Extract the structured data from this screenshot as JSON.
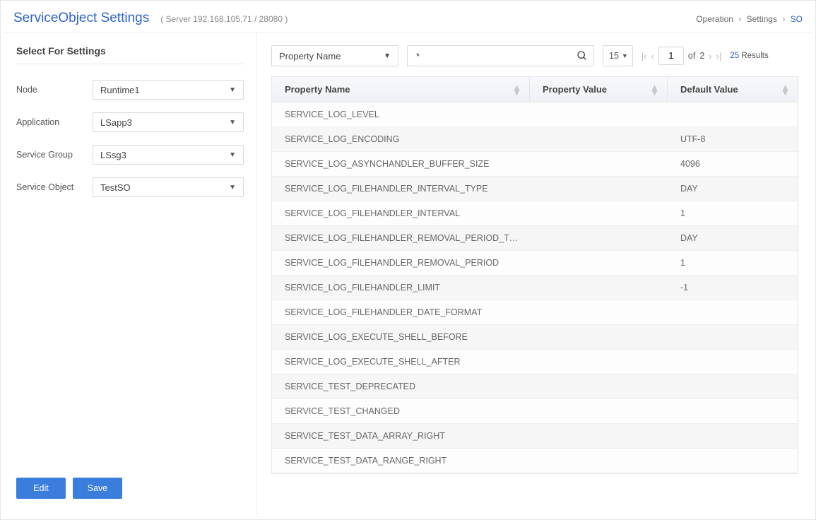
{
  "header": {
    "title": "ServiceObject Settings",
    "server_info": "( Server  192.168.105.71 / 28080 )",
    "breadcrumb": {
      "l1": "Operation",
      "l2": "Settings",
      "l3": "SO"
    }
  },
  "sidebar": {
    "title": "Select For Settings",
    "fields": {
      "node": {
        "label": "Node",
        "value": "Runtime1"
      },
      "application": {
        "label": "Application",
        "value": "LSapp3"
      },
      "serviceGroup": {
        "label": "Service Group",
        "value": "LSsg3"
      },
      "serviceObject": {
        "label": "Service Object",
        "value": "TestSO"
      }
    },
    "buttons": {
      "edit": "Edit",
      "save": "Save"
    }
  },
  "toolbar": {
    "filter_field": "Property Name",
    "search_value": "*",
    "page_size": "15",
    "current_page": "1",
    "total_pages": "2",
    "results_count": "25",
    "results_label": "Results",
    "page_of_label": "of"
  },
  "columns": {
    "name": "Property  Name",
    "value": "Property  Value",
    "default": "Default  Value"
  },
  "rows": [
    {
      "name": "SERVICE_LOG_LEVEL",
      "value": "",
      "default": ""
    },
    {
      "name": "SERVICE_LOG_ENCODING",
      "value": "",
      "default": "UTF-8"
    },
    {
      "name": "SERVICE_LOG_ASYNCHANDLER_BUFFER_SIZE",
      "value": "",
      "default": "4096"
    },
    {
      "name": "SERVICE_LOG_FILEHANDLER_INTERVAL_TYPE",
      "value": "",
      "default": "DAY"
    },
    {
      "name": "SERVICE_LOG_FILEHANDLER_INTERVAL",
      "value": "",
      "default": "1"
    },
    {
      "name": "SERVICE_LOG_FILEHANDLER_REMOVAL_PERIOD_TYPE",
      "value": "",
      "default": "DAY"
    },
    {
      "name": "SERVICE_LOG_FILEHANDLER_REMOVAL_PERIOD",
      "value": "",
      "default": "1"
    },
    {
      "name": "SERVICE_LOG_FILEHANDLER_LIMIT",
      "value": "",
      "default": "-1"
    },
    {
      "name": "SERVICE_LOG_FILEHANDLER_DATE_FORMAT",
      "value": "",
      "default": ""
    },
    {
      "name": "SERVICE_LOG_EXECUTE_SHELL_BEFORE",
      "value": "",
      "default": ""
    },
    {
      "name": "SERVICE_LOG_EXECUTE_SHELL_AFTER",
      "value": "",
      "default": ""
    },
    {
      "name": "SERVICE_TEST_DEPRECATED",
      "value": "",
      "default": ""
    },
    {
      "name": "SERVICE_TEST_CHANGED",
      "value": "",
      "default": ""
    },
    {
      "name": "SERVICE_TEST_DATA_ARRAY_RIGHT",
      "value": "",
      "default": ""
    },
    {
      "name": "SERVICE_TEST_DATA_RANGE_RIGHT",
      "value": "",
      "default": ""
    }
  ]
}
